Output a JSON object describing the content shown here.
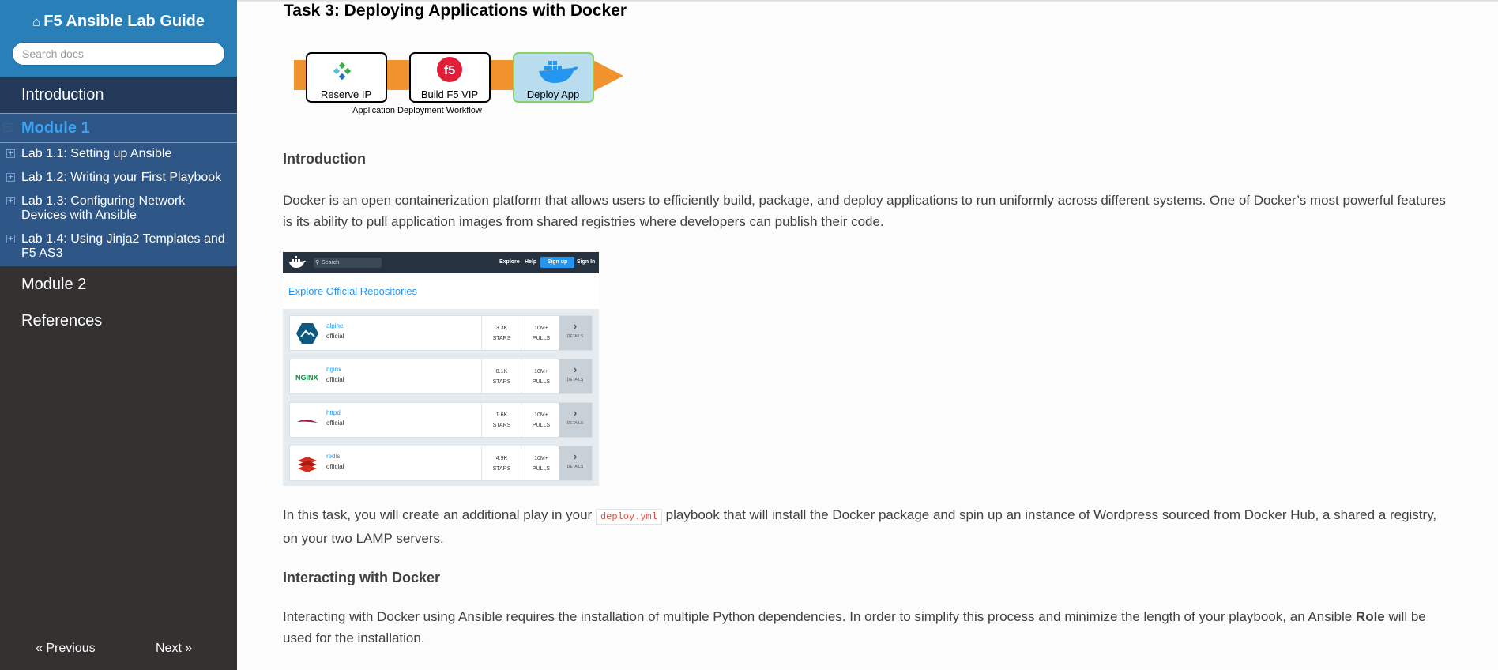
{
  "sidebar": {
    "brand": "F5 Ansible Lab Guide",
    "search_placeholder": "Search docs",
    "introduction": "Introduction",
    "module1": "Module 1",
    "labs": [
      {
        "label": "Lab 1.1: Setting up Ansible"
      },
      {
        "label": "Lab 1.2: Writing your First Playbook"
      },
      {
        "label": "Lab 1.3: Configuring Network Devices with Ansible"
      },
      {
        "label": "Lab 1.4: Using Jinja2 Templates and F5 AS3"
      }
    ],
    "module2": "Module 2",
    "references": "References",
    "prev": "« Previous",
    "next": "Next »"
  },
  "content": {
    "title": "Task 3: Deploying Applications with Docker",
    "workflow": {
      "steps": [
        "Reserve IP",
        "Build F5 VIP",
        "Deploy App"
      ],
      "caption": "Application Deployment Workflow",
      "colors": {
        "arrow": "#f0922e",
        "active": "#b9dcef",
        "active_border": "#86d36b"
      }
    },
    "intro_heading": "Introduction",
    "intro_text": "Docker is an open containerization platform that allows users to efficiently build, package, and deploy applications to run uniformly across different systems. One of Docker’s most powerful features is its ability to pull application images from shared registries where developers can publish their code.",
    "hub": {
      "search": "Search",
      "nav": [
        "Explore",
        "Help",
        "Sign up",
        "Sign In"
      ],
      "title": "Explore Official Repositories",
      "repos": [
        {
          "name": "alpine",
          "sub": "official",
          "stars": "3.3K",
          "pulls": "10M+"
        },
        {
          "name": "nginx",
          "sub": "official",
          "stars": "8.1K",
          "pulls": "10M+"
        },
        {
          "name": "httpd",
          "sub": "official",
          "stars": "1.6K",
          "pulls": "10M+"
        },
        {
          "name": "redis",
          "sub": "official",
          "stars": "4.9K",
          "pulls": "10M+"
        }
      ],
      "stars_label": "STARS",
      "pulls_label": "PULLS",
      "details_label": "DETAILS",
      "nginx_logo_text": "NGINX"
    },
    "task_text_before": "In this task, you will create an additional play in your ",
    "task_code": "deploy.yml",
    "task_text_after": " playbook that will install the Docker package and spin up an instance of Wordpress sourced from Docker Hub, a shared a registry, on your two LAMP servers.",
    "docker_heading": "Interacting with Docker",
    "docker_text_before": "Interacting with Docker using Ansible requires the installation of multiple Python dependencies. In order to simplify this process and minimize the length of your playbook, an Ansible ",
    "docker_text_bold": "Role",
    "docker_text_after": " will be used for the installation."
  }
}
